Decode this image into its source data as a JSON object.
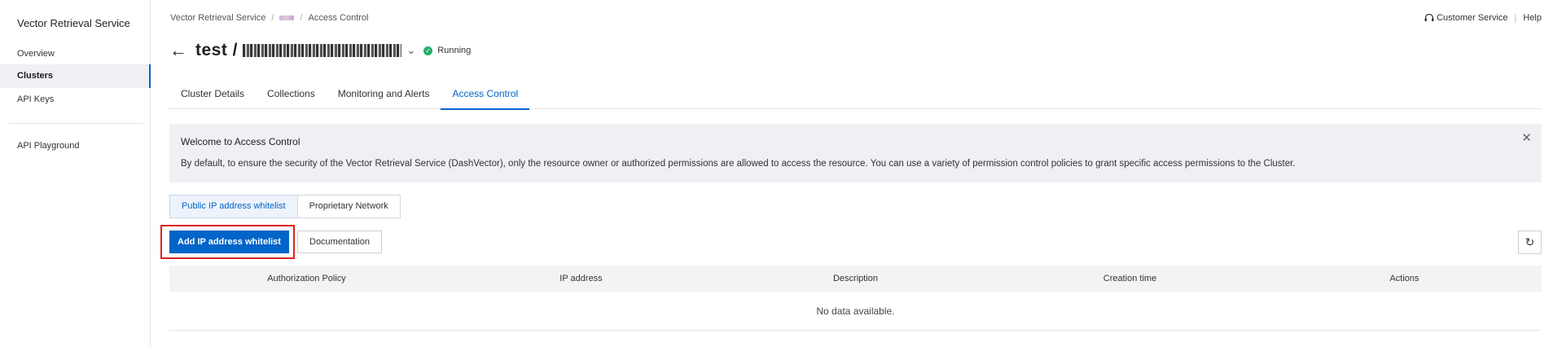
{
  "sidebar": {
    "title": "Vector Retrieval Service",
    "items": [
      {
        "label": "Overview"
      },
      {
        "label": "Clusters"
      },
      {
        "label": "API Keys"
      },
      {
        "label": "API Playground"
      }
    ]
  },
  "breadcrumb": {
    "root": "Vector Retrieval Service",
    "separator": "/",
    "current": "Access Control"
  },
  "top_right": {
    "customer_service": "Customer Service",
    "divider": "|",
    "help": "Help"
  },
  "header": {
    "title_prefix": "test / ",
    "status": "Running"
  },
  "tabs": [
    {
      "label": "Cluster Details"
    },
    {
      "label": "Collections"
    },
    {
      "label": "Monitoring and Alerts"
    },
    {
      "label": "Access Control"
    }
  ],
  "notice": {
    "title": "Welcome to Access Control",
    "text": "By default, to ensure the security of the Vector Retrieval Service (DashVector), only the resource owner or authorized permissions are allowed to access the resource. You can use a variety of permission control policies to grant specific access permissions to the Cluster."
  },
  "segment": {
    "options": [
      {
        "label": "Public IP address whitelist"
      },
      {
        "label": "Proprietary Network"
      }
    ]
  },
  "actions": {
    "add_label": "Add IP address whitelist",
    "docs_label": "Documentation"
  },
  "table": {
    "columns": [
      "Authorization Policy",
      "IP address",
      "Description",
      "Creation time",
      "Actions"
    ],
    "empty_text": "No data available."
  },
  "colors": {
    "accent": "#0064c8",
    "status_running": "#23b066",
    "highlight": "#e02020"
  }
}
